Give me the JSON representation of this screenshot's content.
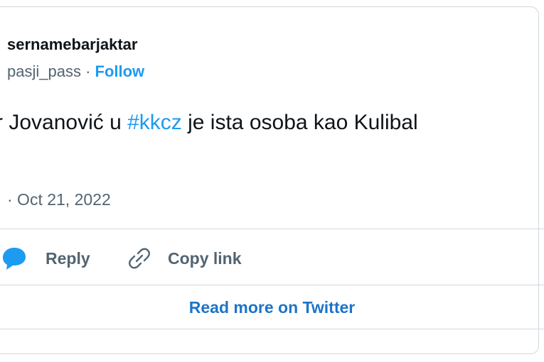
{
  "tweet": {
    "display_name": "sernamebarjaktar",
    "handle": "pasji_pass",
    "separator": " · ",
    "follow_label": "Follow",
    "text_before": "r Jovanović u ",
    "hashtag": "#kkcz",
    "text_after": " je ista osoba kao Kulibal",
    "timestamp": "· Oct 21, 2022"
  },
  "actions": {
    "reply_label": "Reply",
    "copy_link_label": "Copy link",
    "read_more_label": "Read more on Twitter"
  },
  "icons": {
    "reply": "speech-bubble-icon",
    "copy_link": "link-chain-icon"
  },
  "colors": {
    "accent": "#1d9bf0",
    "text": "#0f1419",
    "muted": "#536471",
    "border": "#cfd9de"
  }
}
